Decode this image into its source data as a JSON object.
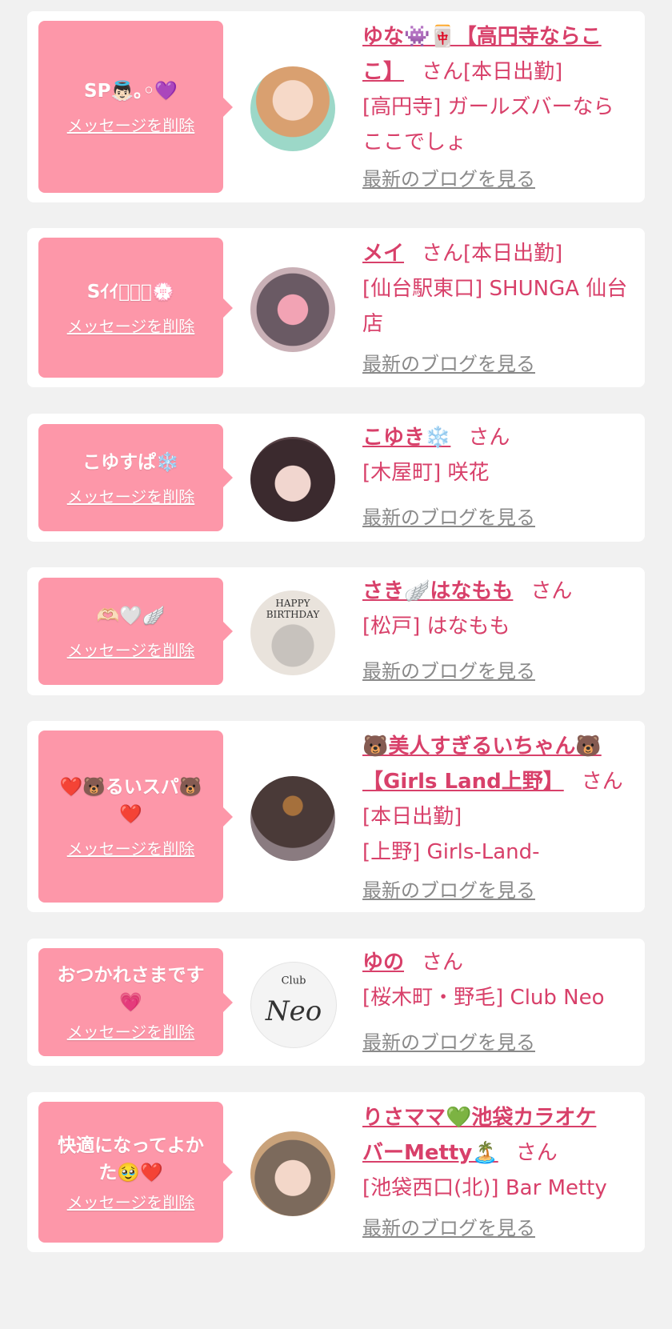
{
  "common": {
    "delete_label": "メッセージを削除",
    "blog_label": "最新のブログを見る",
    "san": "さん"
  },
  "colors": {
    "background": "#f1f1f1",
    "card": "#ffffff",
    "bubble": "#fd97a9",
    "accent_text": "#d8406a",
    "link_gray": "#8a8a8a"
  },
  "messages": [
    {
      "bubble_text": "SP👼🏻｡◦💜",
      "name_line1": "ゆな👾🀄【高円寺ならこ",
      "name_line2": "こ】",
      "status": "[本日出勤]",
      "shop_line1": "[高円寺] ガールズバーなら",
      "shop_line2": "ここでしょ",
      "avatar_icon": "girl-photo"
    },
    {
      "bubble_text": "Sｲｲﾈ🏻🏻💮",
      "name": "メイ",
      "status": "[本日出勤]",
      "shop_line1": "[仙台駅東口] SHUNGA 仙台",
      "shop_line2": "店",
      "avatar_icon": "rose-photo"
    },
    {
      "bubble_text": "こゆすぱ❄️",
      "name": "こゆき❄️",
      "shop": "[木屋町] 咲花",
      "avatar_icon": "girl-photo"
    },
    {
      "bubble_text": "🫶🏻🤍🪽",
      "name_a": "さき🪽",
      "name_b": "はなもも",
      "shop": "[松戸] はなもも",
      "avatar_text": "HAPPY BIRTHDAY",
      "avatar_icon": "birthday-photo"
    },
    {
      "bubble_text_line1": "❤️🐻るいスパ🐻",
      "bubble_text_line2": "❤️",
      "name_line1": "🐻美人すぎるいちゃん🐻",
      "name_line2": "【Girls Land上野】",
      "status": "[本日出勤]",
      "shop": "[上野] Girls-Land-",
      "avatar_icon": "bear-sticker-photo"
    },
    {
      "bubble_text_line1": "おつかれさまです",
      "bubble_text_line2": "💗",
      "name": "ゆの",
      "shop": "[桜木町・野毛] Club Neo",
      "avatar_text_small": "Club",
      "avatar_text_big": "Neo",
      "avatar_icon": "club-neo-logo"
    },
    {
      "bubble_text_line1": "快適になってよか",
      "bubble_text_line2": "た🥹❤️",
      "name_line1": "りさママ💚池袋カラオケ",
      "name_line2": "バーMetty🏝️",
      "shop": "[池袋西口(北)] Bar Metty",
      "avatar_icon": "girl-photo"
    }
  ]
}
